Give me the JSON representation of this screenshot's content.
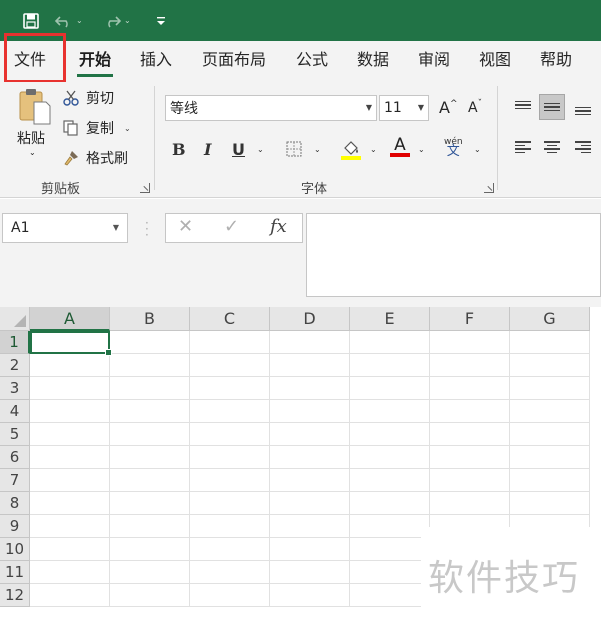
{
  "quick_access": {
    "save_icon": "save-icon",
    "undo_icon": "undo-icon",
    "redo_icon": "redo-icon",
    "customize_icon": "customize-toolbar-icon"
  },
  "tabs": [
    {
      "label": "文件"
    },
    {
      "label": "开始"
    },
    {
      "label": "插入"
    },
    {
      "label": "页面布局"
    },
    {
      "label": "公式"
    },
    {
      "label": "数据"
    },
    {
      "label": "审阅"
    },
    {
      "label": "视图"
    },
    {
      "label": "帮助"
    }
  ],
  "active_tab": "开始",
  "highlight_color": "#e8322f",
  "accent_color": "#217346",
  "clipboard": {
    "paste_label": "粘贴",
    "cut_label": "剪切",
    "copy_label": "复制",
    "format_painter_label": "格式刷",
    "group_label": "剪贴板"
  },
  "font": {
    "font_name": "等线",
    "font_size": "11",
    "grow_label": "A",
    "shrink_label": "A",
    "bold_label": "B",
    "italic_label": "I",
    "underline_label": "U",
    "font_color_label": "A",
    "phonetic_label": "wén",
    "phonetic_sub": "文",
    "group_label": "字体",
    "fill_color": "#ffff00",
    "font_color": "#e00000"
  },
  "formula_bar": {
    "name_box": "A1",
    "cancel": "✕",
    "enter": "✓",
    "fx": "fx",
    "formula": ""
  },
  "grid": {
    "columns": [
      "A",
      "B",
      "C",
      "D",
      "E",
      "F",
      "G"
    ],
    "rows": [
      "1",
      "2",
      "3",
      "4",
      "5",
      "6",
      "7",
      "8",
      "9",
      "10",
      "11",
      "12"
    ],
    "active_cell": "A1"
  },
  "watermark": "软件技巧"
}
